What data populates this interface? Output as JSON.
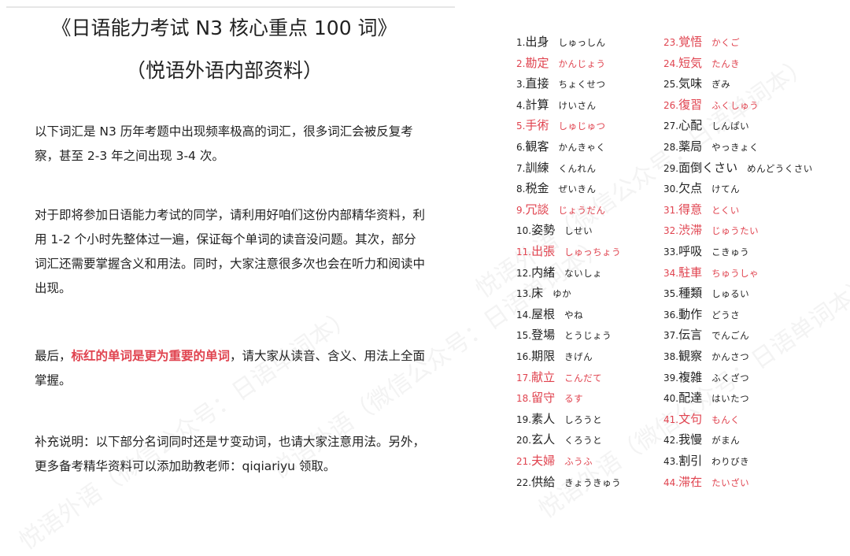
{
  "header": {
    "title_line1": "《日语能力考试 N3 核心重点 100 词》",
    "title_line2": "（悦语外语内部资料）"
  },
  "intro": {
    "p1": "以下词汇是 N3 历年考题中出现频率极高的词汇，很多词汇会被反复考察，甚至 2-3 年之间出现 3-4 次。",
    "p2": "对于即将参加日语能力考试的同学，请利用好咱们这份内部精华资料，利用 1-2 个小时先整体过一遍，保证每个单词的读音没问题。其次，部分词汇还需要掌握含义和用法。同时，大家注意很多次也会在听力和阅读中出现。",
    "p3_before": "最后，",
    "p3_highlight": "标红的单词是更为重要的单词",
    "p3_after": "，请大家从读音、含义、用法上全面掌握。",
    "p4": "补充说明：以下部分名词同时还是サ变动词，也请大家注意用法。另外，更多备考精华资料可以添加助教老师：qiqiariyu  领取。"
  },
  "colors": {
    "red": "#e0434f",
    "text": "#222222"
  },
  "watermark": "悦语外语（微信公众号：日语单词本）",
  "vocab_col1": [
    {
      "num": "1.",
      "word": "出身",
      "kana": "しゅっしん",
      "red": false
    },
    {
      "num": "2.",
      "word": "勘定",
      "kana": "かんじょう",
      "red": true
    },
    {
      "num": "3.",
      "word": "直接",
      "kana": "ちょくせつ",
      "red": false
    },
    {
      "num": "4.",
      "word": "計算",
      "kana": "けいさん",
      "red": false
    },
    {
      "num": "5.",
      "word": "手術",
      "kana": "しゅじゅつ",
      "red": true
    },
    {
      "num": "6.",
      "word": "観客",
      "kana": "かんきゃく",
      "red": false
    },
    {
      "num": "7.",
      "word": "訓練",
      "kana": "くんれん",
      "red": false
    },
    {
      "num": "8.",
      "word": "税金",
      "kana": "ぜいきん",
      "red": false
    },
    {
      "num": "9.",
      "word": "冗談",
      "kana": "じょうだん",
      "red": true
    },
    {
      "num": "10.",
      "word": "姿勢",
      "kana": "しせい",
      "red": false
    },
    {
      "num": "11.",
      "word": "出張",
      "kana": "しゅっちょう",
      "red": true
    },
    {
      "num": "12.",
      "word": "内緒",
      "kana": "ないしょ",
      "red": false
    },
    {
      "num": "13.",
      "word": "床",
      "kana": "ゆか",
      "red": false
    },
    {
      "num": "14.",
      "word": "屋根",
      "kana": "やね",
      "red": false
    },
    {
      "num": "15.",
      "word": "登場",
      "kana": "とうじょう",
      "red": false
    },
    {
      "num": "16.",
      "word": "期限",
      "kana": "きげん",
      "red": false
    },
    {
      "num": "17.",
      "word": "献立",
      "kana": "こんだて",
      "red": true
    },
    {
      "num": "18.",
      "word": "留守",
      "kana": "るす",
      "red": true
    },
    {
      "num": "19.",
      "word": "素人",
      "kana": "しろうと",
      "red": false
    },
    {
      "num": "20.",
      "word": "玄人",
      "kana": "くろうと",
      "red": false
    },
    {
      "num": "21.",
      "word": "夫婦",
      "kana": "ふうふ",
      "red": true
    },
    {
      "num": "22.",
      "word": "供給",
      "kana": "きょうきゅう",
      "red": false
    }
  ],
  "vocab_col2": [
    {
      "num": "23.",
      "word": "覚悟",
      "kana": "かくご",
      "red": true
    },
    {
      "num": "24.",
      "word": "短気",
      "kana": "たんき",
      "red": true
    },
    {
      "num": "25.",
      "word": "気味",
      "kana": "ぎみ",
      "red": false
    },
    {
      "num": "26.",
      "word": "復習",
      "kana": "ふくしゅう",
      "red": true
    },
    {
      "num": "27.",
      "word": "心配",
      "kana": "しんぱい",
      "red": false
    },
    {
      "num": "28.",
      "word": "薬局",
      "kana": "やっきょく",
      "red": false
    },
    {
      "num": "29.",
      "word": "面倒くさい",
      "kana": "めんどうくさい",
      "red": false
    },
    {
      "num": "30.",
      "word": "欠点",
      "kana": "けてん",
      "red": false
    },
    {
      "num": "31.",
      "word": "得意",
      "kana": "とくい",
      "red": true
    },
    {
      "num": "32.",
      "word": "渋滞",
      "kana": "じゅうたい",
      "red": true
    },
    {
      "num": "33.",
      "word": "呼吸",
      "kana": "こきゅう",
      "red": false
    },
    {
      "num": "34.",
      "word": "駐車",
      "kana": "ちゅうしゃ",
      "red": true
    },
    {
      "num": "35.",
      "word": "種類",
      "kana": "しゅるい",
      "red": false
    },
    {
      "num": "36.",
      "word": "動作",
      "kana": "どうさ",
      "red": false
    },
    {
      "num": "37.",
      "word": "伝言",
      "kana": "でんごん",
      "red": false
    },
    {
      "num": "38.",
      "word": "観察",
      "kana": "かんさつ",
      "red": false
    },
    {
      "num": "39.",
      "word": "複雑",
      "kana": "ふくざつ",
      "red": false
    },
    {
      "num": "40.",
      "word": "配達",
      "kana": "はいたつ",
      "red": false
    },
    {
      "num": "41.",
      "word": "文句",
      "kana": "もんく",
      "red": true
    },
    {
      "num": "42.",
      "word": "我慢",
      "kana": "がまん",
      "red": false
    },
    {
      "num": "43.",
      "word": "割引",
      "kana": "わりびき",
      "red": false
    },
    {
      "num": "44.",
      "word": "滞在",
      "kana": "たいざい",
      "red": true
    }
  ]
}
